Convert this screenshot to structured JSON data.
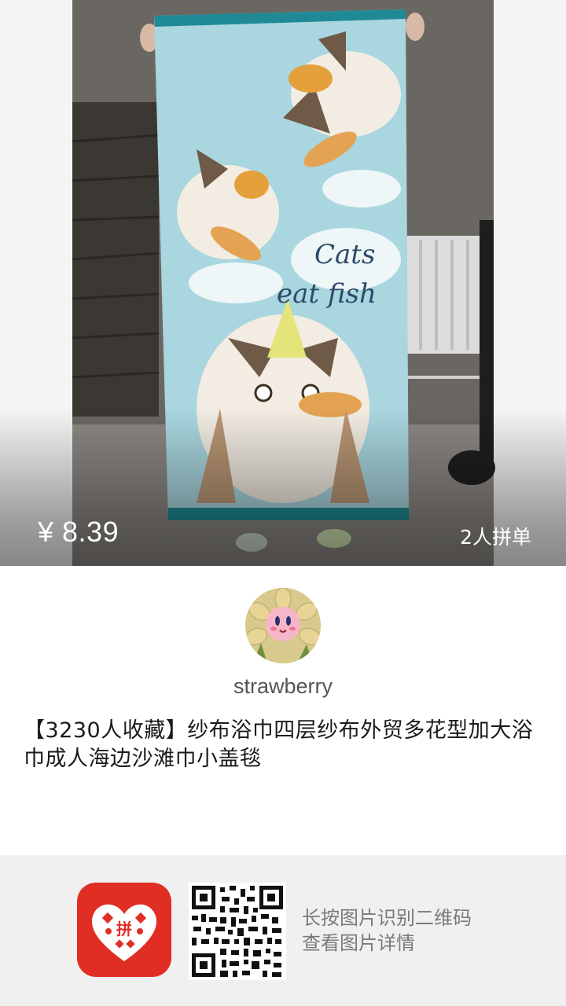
{
  "product": {
    "price": "¥ 8.39",
    "group_count": "2人拼单",
    "title": "【3230人收藏】纱布浴巾四层纱布外贸多花型加大浴巾成人海边沙滩巾小盖毯",
    "towel_text_line1": "Cats",
    "towel_text_line2": "eat fish"
  },
  "sharer": {
    "name": "strawberry"
  },
  "footer": {
    "hint_line1": "长按图片识别二维码",
    "hint_line2": "查看图片详情",
    "logo_glyph": "拼"
  },
  "colors": {
    "brand_red": "#e02e24",
    "towel_blue": "#a9d6df",
    "towel_border": "#1f8a96"
  },
  "icons": [
    "pinduoduo-logo-icon",
    "qr-code-icon"
  ]
}
